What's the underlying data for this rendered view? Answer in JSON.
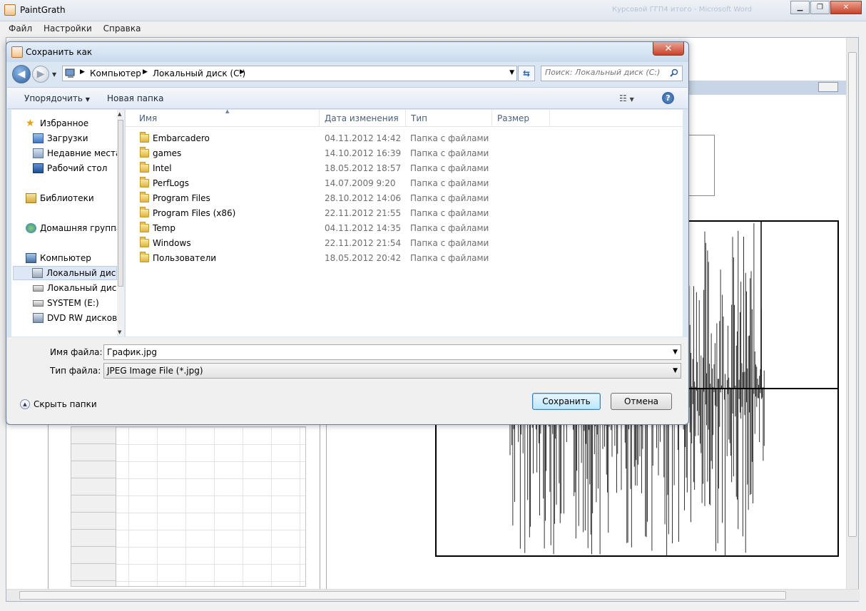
{
  "app": {
    "title": "PaintGrath",
    "background_window_title": "Курсовой ГГП4 итого - Microsoft Word",
    "menu": [
      "Файл",
      "Настройки",
      "Справка"
    ]
  },
  "dialog": {
    "title": "Сохранить как",
    "breadcrumbs": [
      "Компьютер",
      "Локальный диск (C:)"
    ],
    "search_placeholder": "Поиск: Локальный диск (C:)",
    "toolbar": {
      "organize": "Упорядочить",
      "new_folder": "Новая папка"
    },
    "nav": {
      "favorites": {
        "label": "Избранное",
        "items": [
          "Загрузки",
          "Недавние места",
          "Рабочий стол"
        ]
      },
      "libraries": "Библиотеки",
      "homegroup": "Домашняя группа",
      "computer": {
        "label": "Компьютер",
        "items": [
          "Локальный диск (C:)",
          "Локальный диск (D:)",
          "SYSTEM (E:)",
          "DVD RW дисковод"
        ]
      }
    },
    "columns": [
      "Имя",
      "Дата изменения",
      "Тип",
      "Размер"
    ],
    "files": [
      {
        "name": "Embarcadero",
        "date": "04.11.2012 14:42",
        "type": "Папка с файлами"
      },
      {
        "name": "games",
        "date": "14.10.2012 16:39",
        "type": "Папка с файлами"
      },
      {
        "name": "Intel",
        "date": "18.05.2012 18:57",
        "type": "Папка с файлами"
      },
      {
        "name": "PerfLogs",
        "date": "14.07.2009 9:20",
        "type": "Папка с файлами"
      },
      {
        "name": "Program Files",
        "date": "28.10.2012 14:06",
        "type": "Папка с файлами"
      },
      {
        "name": "Program Files (x86)",
        "date": "22.11.2012 21:55",
        "type": "Папка с файлами"
      },
      {
        "name": "Temp",
        "date": "04.11.2012 14:35",
        "type": "Папка с файлами"
      },
      {
        "name": "Windows",
        "date": "22.11.2012 21:54",
        "type": "Папка с файлами"
      },
      {
        "name": "Пользователи",
        "date": "18.05.2012 20:42",
        "type": "Папка с файлами"
      }
    ],
    "filename_label": "Имя файла:",
    "filename_value": "График.jpg",
    "filetype_label": "Тип файла:",
    "filetype_value": "JPEG Image File (*.jpg)",
    "hide_folders": "Скрыть папки",
    "save_button": "Сохранить",
    "cancel_button": "Отмена"
  },
  "colors": {
    "accent": "#3c7fb1",
    "close": "#c7442a",
    "folder": "#ddb441"
  }
}
